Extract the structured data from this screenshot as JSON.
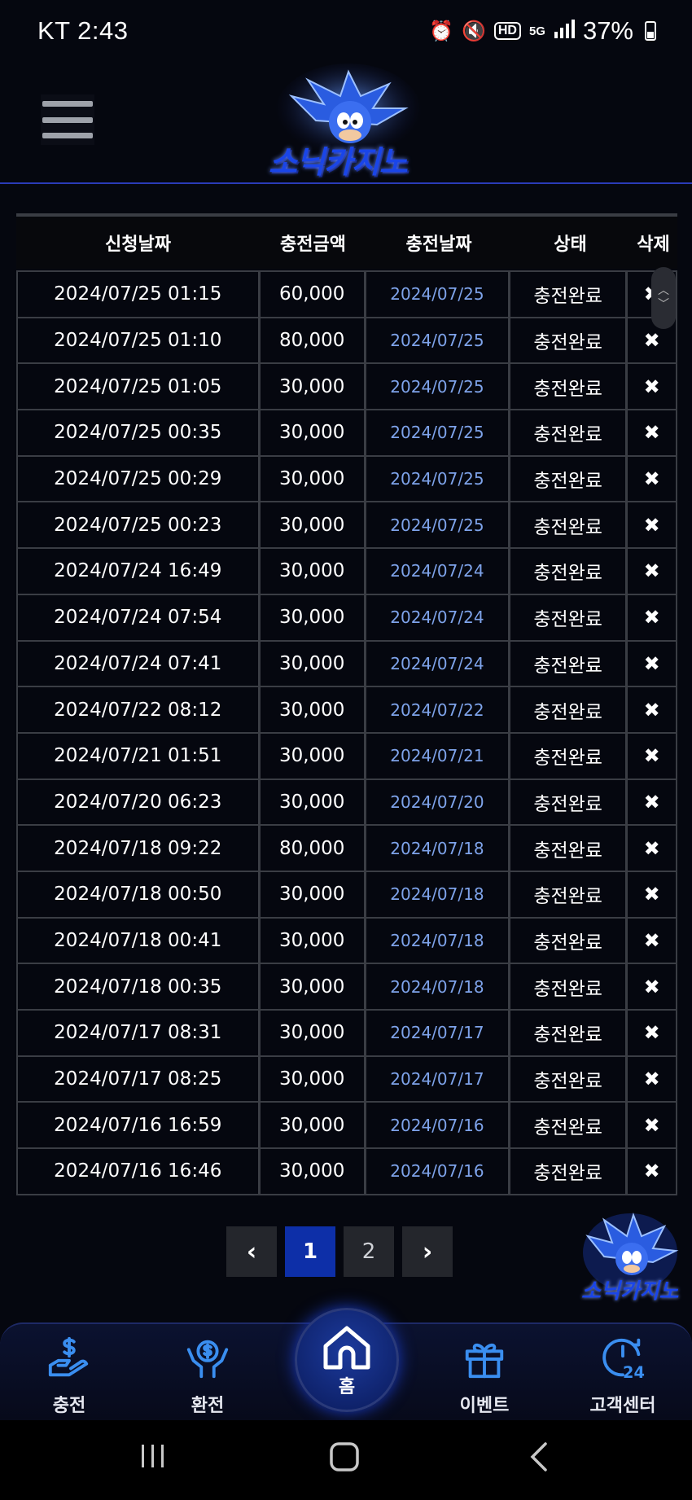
{
  "status_bar": {
    "carrier_time": "KT 2:43",
    "battery": "37%",
    "icons": [
      "alarm-icon",
      "mute-icon",
      "hd-icon",
      "5g-icon",
      "signal-icon",
      "battery-icon"
    ]
  },
  "header": {
    "logo_text": "소닉카지노"
  },
  "table": {
    "headers": [
      "신청날짜",
      "충전금액",
      "충전날짜",
      "상태",
      "삭제"
    ],
    "rows": [
      [
        "2024/07/25 01:15",
        "60,000",
        "2024/07/25",
        "충전완료",
        "✖"
      ],
      [
        "2024/07/25 01:10",
        "80,000",
        "2024/07/25",
        "충전완료",
        "✖"
      ],
      [
        "2024/07/25 01:05",
        "30,000",
        "2024/07/25",
        "충전완료",
        "✖"
      ],
      [
        "2024/07/25 00:35",
        "30,000",
        "2024/07/25",
        "충전완료",
        "✖"
      ],
      [
        "2024/07/25 00:29",
        "30,000",
        "2024/07/25",
        "충전완료",
        "✖"
      ],
      [
        "2024/07/25 00:23",
        "30,000",
        "2024/07/25",
        "충전완료",
        "✖"
      ],
      [
        "2024/07/24 16:49",
        "30,000",
        "2024/07/24",
        "충전완료",
        "✖"
      ],
      [
        "2024/07/24 07:54",
        "30,000",
        "2024/07/24",
        "충전완료",
        "✖"
      ],
      [
        "2024/07/24 07:41",
        "30,000",
        "2024/07/24",
        "충전완료",
        "✖"
      ],
      [
        "2024/07/22 08:12",
        "30,000",
        "2024/07/22",
        "충전완료",
        "✖"
      ],
      [
        "2024/07/21 01:51",
        "30,000",
        "2024/07/21",
        "충전완료",
        "✖"
      ],
      [
        "2024/07/20 06:23",
        "30,000",
        "2024/07/20",
        "충전완료",
        "✖"
      ],
      [
        "2024/07/18 09:22",
        "80,000",
        "2024/07/18",
        "충전완료",
        "✖"
      ],
      [
        "2024/07/18 00:50",
        "30,000",
        "2024/07/18",
        "충전완료",
        "✖"
      ],
      [
        "2024/07/18 00:41",
        "30,000",
        "2024/07/18",
        "충전완료",
        "✖"
      ],
      [
        "2024/07/18 00:35",
        "30,000",
        "2024/07/18",
        "충전완료",
        "✖"
      ],
      [
        "2024/07/17 08:31",
        "30,000",
        "2024/07/17",
        "충전완료",
        "✖"
      ],
      [
        "2024/07/17 08:25",
        "30,000",
        "2024/07/17",
        "충전완료",
        "✖"
      ],
      [
        "2024/07/16 16:59",
        "30,000",
        "2024/07/16",
        "충전완료",
        "✖"
      ],
      [
        "2024/07/16 16:46",
        "30,000",
        "2024/07/16",
        "충전완료",
        "✖"
      ]
    ]
  },
  "pagination": {
    "prev": "‹",
    "pages": [
      "1",
      "2"
    ],
    "current": "1",
    "next": "›"
  },
  "floating_logo_text": "소닉카지노",
  "bottom_nav": {
    "items": [
      {
        "label": "충전",
        "icon": "deposit-icon"
      },
      {
        "label": "환전",
        "icon": "exchange-icon"
      },
      {
        "label": "홈",
        "icon": "home-icon"
      },
      {
        "label": "이벤트",
        "icon": "gift-icon"
      },
      {
        "label": "고객센터",
        "icon": "support-24-icon"
      }
    ]
  },
  "colors": {
    "accent": "#0d2fa8",
    "date_text": "#7ea3ea",
    "background": "#05070f"
  }
}
